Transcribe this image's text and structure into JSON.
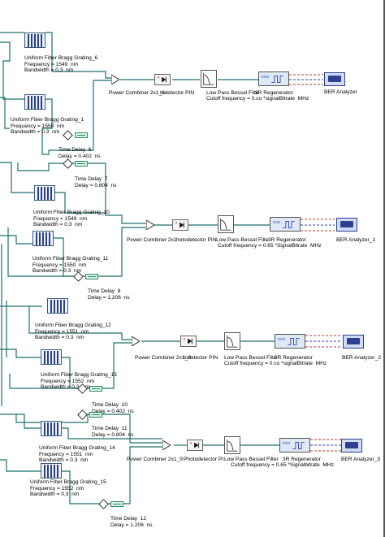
{
  "components": {
    "fbg_6": {
      "title": "Uniform Fiber Bragg Grating_6",
      "p1": "Frequency = 1549  nm",
      "p2": "Bandwidth = 0.3  nm"
    },
    "fbg_1": {
      "title": "Uniform Fiber Bragg Grating_1",
      "p1": "Frequency = 1550  nm",
      "p2": "Bandwidth = 0.3  nm"
    },
    "fbg_10": {
      "title": "Uniform Fiber Bragg Grating_10",
      "p1": "Frequency = 1549  nm",
      "p2": "Bandwidth = 0.3  nm"
    },
    "fbg_11": {
      "title": "Uniform Fiber Bragg Grating_11",
      "p1": "Frequency = 1550  nm",
      "p2": "Bandwidth = 0.3  nm"
    },
    "fbg_12": {
      "title": "Uniform Fiber Bragg Grating_12",
      "p1": "Frequency = 1551  nm",
      "p2": "Bandwidth = 0.3  nm"
    },
    "fbg_13": {
      "title": "Uniform Fiber Bragg Grating_13",
      "p1": "Frequency = 1552  nm",
      "p2": "Bandwidth = 0.3  nm"
    },
    "fbg_14": {
      "title": "Uniform Fiber Bragg Grating_14",
      "p1": "Frequency = 1551  nm",
      "p2": "Bandwidth = 0.3  nm"
    },
    "fbg_15": {
      "title": "Uniform Fiber Bragg Grating_15",
      "p1": "Frequency = 1552  nm",
      "p2": "Bandwidth = 0.3  nm"
    },
    "td_6": {
      "title": "Time Delay  6",
      "p1": "Delay = 0.402  ns"
    },
    "td_7": {
      "title": "Time Delay  7",
      "p1": "Delay = 0.804  ns"
    },
    "td_8": {
      "title": "Time Delay  8",
      "p1": "Delay = 1.206  ns"
    },
    "td_10": {
      "title": "Time Delay  10",
      "p1": "Delay = 0.402  ns"
    },
    "td_11": {
      "title": "Time Delay  11",
      "p1": "Delay = 0.804  ns"
    },
    "td_12": {
      "title": "Time Delay  12",
      "p1": "Delay = 1.206  ns"
    },
    "chain_1": {
      "combiner": "Power Combiner 2x1_6",
      "pin": "todetector PIN",
      "lpf": "Low Pass Bessel Filte",
      "regen": "3R Regenerator",
      "cutoff": "Cutoff frequency = 0.co *signalBitrate  MHz",
      "ber": "BER Analyzer"
    },
    "chain_2": {
      "combiner": "Power Combiner 2x1",
      "pin": "hotodetector PIN",
      "lpf": "Low Pass Bessel Filte",
      "regen": "3R Regenerator",
      "cutoff": "Cutoff frequency = 0.65 *SignalBitrate  MHz",
      "ber": "BER Analyzer_1"
    },
    "chain_3": {
      "combiner": "Power Combiner 2x1_2",
      "pin": "todetector PIN",
      "lpf": "Low Pass Bessel Filte",
      "regen": "3R Regenerator",
      "cutoff": "Cutoff frequency = 0.co *signalBitrate  MHz",
      "ber": "BER Analyzer_2"
    },
    "chain_4": {
      "combiner": "Power Combiner 2x1_9",
      "pin": "Photodetector PI",
      "lpf": "Low Pass Bessel Filter",
      "regen": "3R Regenerator",
      "cutoff": "Cutoff frequency = 0.65 *Signalbitrate  MHz",
      "ber": "BER Analyzer_3"
    }
  },
  "colors": {
    "wire": "#1f6e6e",
    "signal_red": "#c0392b",
    "signal_blue": "#2e3fae",
    "fbg_bar": "#2b3e8c"
  }
}
